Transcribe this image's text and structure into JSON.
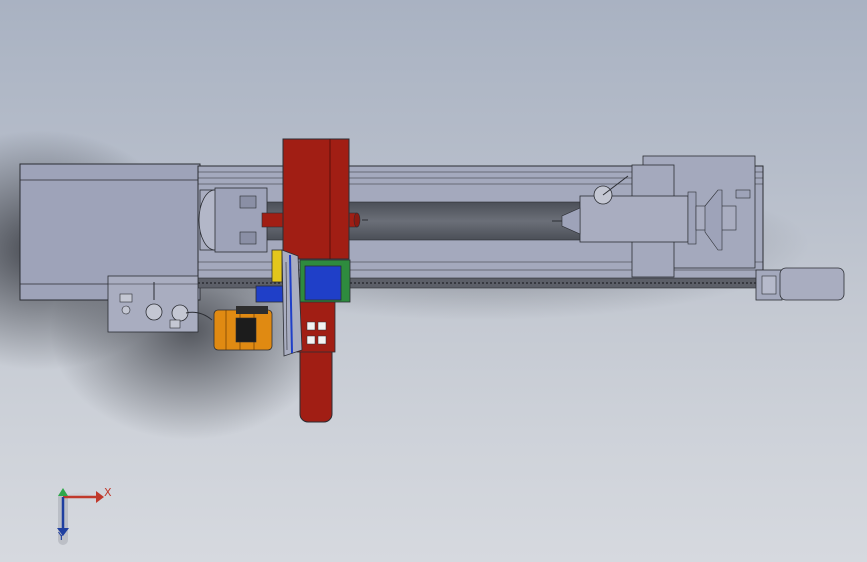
{
  "view": {
    "type": "cad-model-viewport",
    "background_top": "#a9b2c2",
    "background_bottom": "#d6d9df"
  },
  "colors": {
    "bed": "#9aa0b8",
    "carriage": "#a11e14",
    "tailstock": "#9aa0b8",
    "compound_blue": "#1f3fc8",
    "motor_orange": "#e08a12",
    "gear_yellow": "#e3c61c",
    "rest_green": "#2e8b3e"
  },
  "axes": {
    "x_label": "X",
    "y_label": "Y",
    "x_color": "#c0392b",
    "y_color": "#1f3fa0",
    "origin_color": "#2ea84a"
  }
}
